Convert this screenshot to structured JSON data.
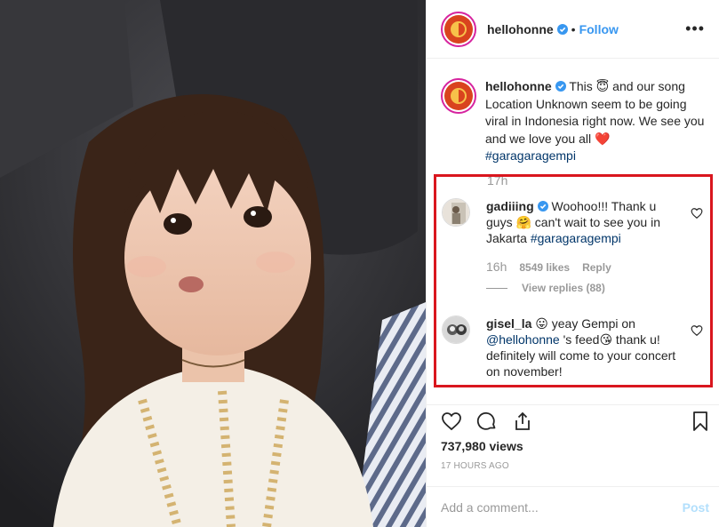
{
  "post": {
    "username": "hellohonne",
    "follow_label": "Follow",
    "separator": "•",
    "more_label": "•••"
  },
  "caption": {
    "username": "hellohonne",
    "text_before": "This ",
    "emoji_1": "😇",
    "text_middle": " and our song Location Unknown seem to be going viral in Indonesia right now. We see you and we love you all ",
    "emoji_2": "❤️",
    "hashtag": "#garagaragempi",
    "partial_time": "17h"
  },
  "comments": [
    {
      "username": "gadiiing",
      "text_before": " Woohoo!!! Thank u guys ",
      "emoji": "🤗",
      "text_after": " can't wait to see you in Jakarta ",
      "hashtag": "#garagaragempi",
      "time": "16h",
      "likes": "8549 likes",
      "reply_label": "Reply",
      "view_replies": "View replies (88)"
    },
    {
      "username": "gisel_la",
      "emoji_1": "😛",
      "text_1": " yeay Gempi on ",
      "mention": "@hellohonne",
      "text_2": " 's feed",
      "emoji_2": "😘",
      "text_3": " thank u! definitely will come to your concert on november!"
    }
  ],
  "stats": {
    "views": "737,980 views",
    "age": "17 HOURS AGO"
  },
  "add_comment": {
    "placeholder": "Add a comment...",
    "post_label": "Post"
  },
  "colors": {
    "accent": "#3897f0",
    "highlight_box": "#d9161e",
    "hashtag": "#003569",
    "muted": "#999999"
  },
  "icons": [
    "heart-icon",
    "comment-icon",
    "share-icon",
    "bookmark-icon",
    "verified-badge-icon",
    "small-heart-icon"
  ]
}
